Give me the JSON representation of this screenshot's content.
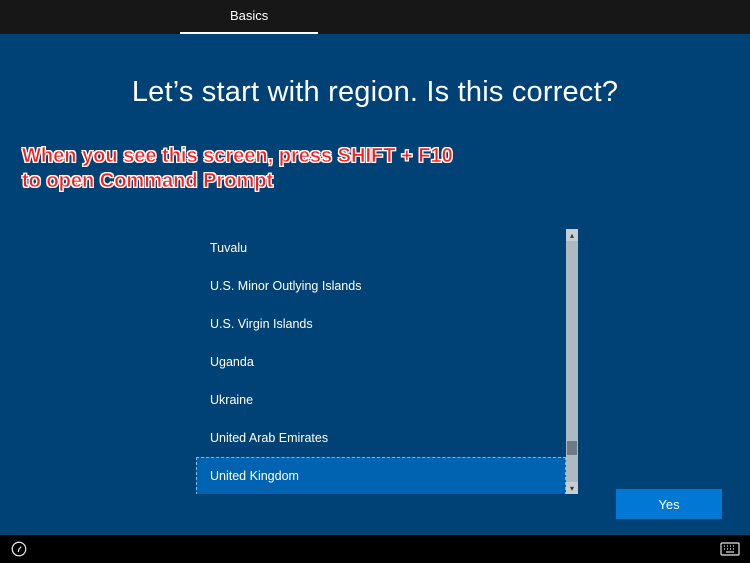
{
  "tabs": {
    "active": "Basics"
  },
  "heading": "Let’s start with region. Is this correct?",
  "annotation": {
    "line1": "When you see this screen, press SHIFT + F10",
    "line2": "to open Command Prompt"
  },
  "region_list": {
    "items": [
      {
        "label": "Tuvalu",
        "selected": false
      },
      {
        "label": "U.S. Minor Outlying Islands",
        "selected": false
      },
      {
        "label": "U.S. Virgin Islands",
        "selected": false
      },
      {
        "label": "Uganda",
        "selected": false
      },
      {
        "label": "Ukraine",
        "selected": false
      },
      {
        "label": "United Arab Emirates",
        "selected": false
      },
      {
        "label": "United Kingdom",
        "selected": true
      }
    ],
    "scroll": {
      "thumb_top_pct": 83,
      "thumb_height_pct": 6
    }
  },
  "buttons": {
    "yes": "Yes"
  },
  "icons": {
    "ease": "ease-of-access-icon",
    "keyboard": "keyboard-icon"
  }
}
